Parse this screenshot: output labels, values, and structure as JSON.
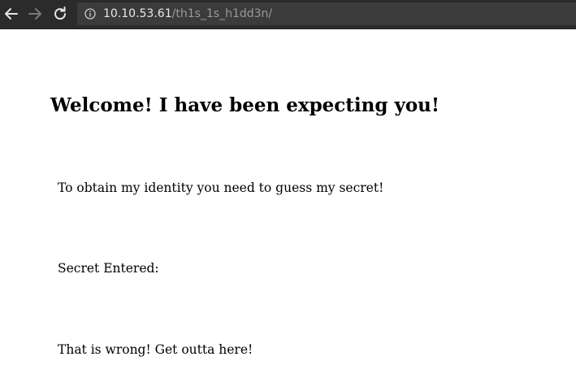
{
  "browser": {
    "back_icon": "arrow-left-icon",
    "forward_icon": "arrow-right-icon",
    "reload_icon": "reload-icon",
    "info_icon": "info-icon",
    "url_host": "10.10.53.61",
    "url_path": "/th1s_1s_h1dd3n/",
    "bar_color": "#2b2b2b",
    "url_box_color": "#3b3b3b"
  },
  "page": {
    "heading": "Welcome! I have been expecting you!",
    "intro": "To obtain my identity you need to guess my secret!",
    "secret_label": "Secret Entered:",
    "result": "That is wrong! Get outta here!"
  }
}
